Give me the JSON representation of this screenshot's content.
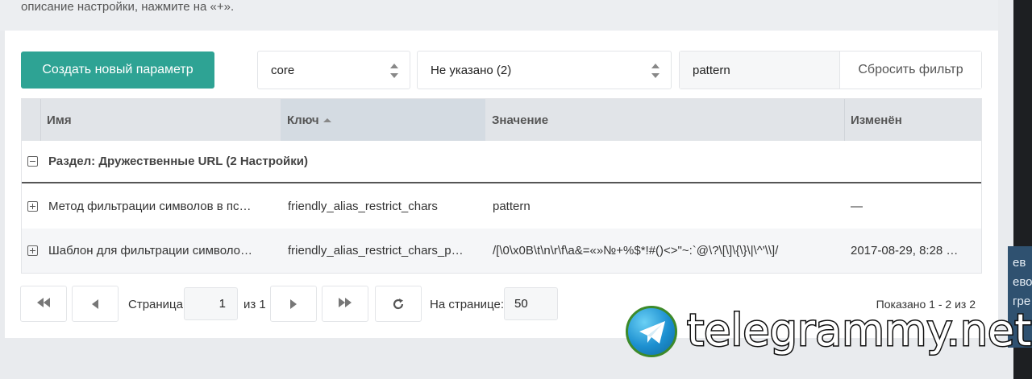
{
  "intro_text": "описание настройки, нажмите на «+».",
  "toolbar": {
    "create_label": "Создать новый параметр",
    "namespace_value": "core",
    "area_value": "Не указано (2)",
    "filter_value": "pattern",
    "reset_label": "Сбросить фильтр"
  },
  "grid": {
    "columns": [
      "Имя",
      "Ключ",
      "Значение",
      "Изменён"
    ],
    "group_label": "Раздел: Дружественные URL (2 Настройки)",
    "rows": [
      {
        "name": "Метод фильтрации символов в пс…",
        "key": "friendly_alias_restrict_chars",
        "value": "pattern",
        "edited": "—"
      },
      {
        "name": "Шаблон для фильтрации символо…",
        "key": "friendly_alias_restrict_chars_p…",
        "value": "/[\\0\\x0B\\t\\n\\r\\f\\a&=«»№+%$*!#()<>\"~:`@\\?\\[\\]\\{\\}\\|\\^'\\\\]/",
        "edited": "2017-08-29, 8:28 …"
      }
    ]
  },
  "pager": {
    "page_label": "Страница",
    "page_value": "1",
    "of_label": "из 1",
    "per_page_label": "На странице:",
    "per_page_value": "50",
    "shown": "Показано 1 - 2 из 2"
  },
  "side_text": [
    "ев",
    "ево",
    "гре"
  ],
  "watermark": "telegrammy.net",
  "colors": {
    "accent": "#2ea394",
    "header_bg": "#e1e4e8",
    "sorted_header_bg": "#d4dbe2"
  }
}
